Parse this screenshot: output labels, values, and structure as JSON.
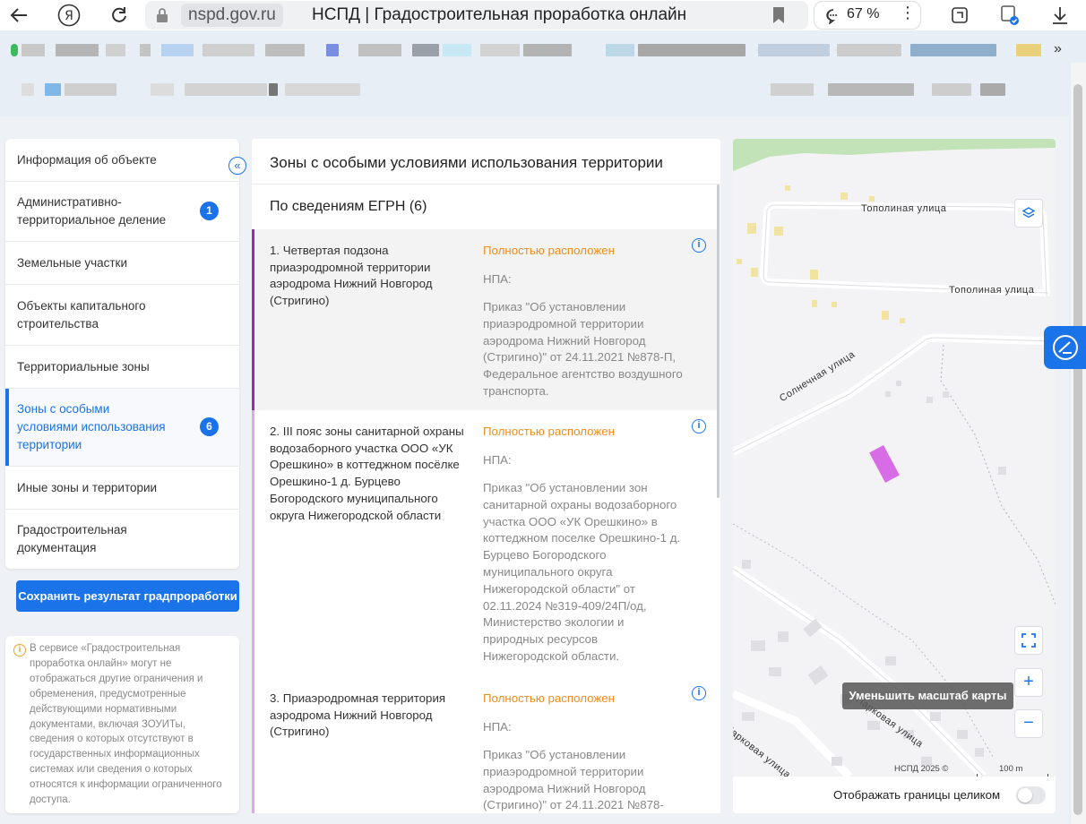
{
  "browser": {
    "domain": "nspd.gov.ru",
    "title": "НСПД | Градостроительная проработка онлайн",
    "zoom": "67 %"
  },
  "nav": {
    "collapse_symbol": "«",
    "items": [
      {
        "label": "Информация об объекте"
      },
      {
        "label": "Административно-\nтерриториальное деление",
        "badge": "1"
      },
      {
        "label": "Земельные участки"
      },
      {
        "label": "Объекты капитального\nстроительства"
      },
      {
        "label": "Территориальные зоны"
      },
      {
        "label": "Зоны с особыми\nусловиями использования\nтерритории",
        "badge": "6",
        "active": true
      },
      {
        "label": "Иные зоны и территории"
      },
      {
        "label": "Градостроительная\nдокументация"
      }
    ]
  },
  "save_button": "Сохранить результат градпроработки",
  "info_note": "В сервисе «Градостроительная проработка онлайн» могут не отображаться другие ограничения и обременения, предусмотренные действующими нормативными документами, включая ЗОУИТы, сведения о которых отсутствуют в государственных информационных системах или сведения о которых относятся к информации ограниченного доступа.",
  "main": {
    "title": "Зоны с особыми условиями использования территории",
    "section": "По сведениям ЕГРН (6)",
    "npa_label": "НПА:",
    "zones": [
      {
        "name": "1. Четвертая подзона приаэродромной территории аэродрома Нижний Новгород (Стригино)",
        "status": "Полностью расположен",
        "npa": "Приказ \"Об установлении приаэродромной территории аэродрома Нижний Новгород (Стригино)\" от 24.11.2021 №878-П, Федеральное агентство воздушного транспорта.",
        "color": "#9c27b0"
      },
      {
        "name": "2. III пояс зоны санитарной охраны водозаборного участка ООО «УК Орешкино» в коттеджном посёлке Орешкино-1 д. Бурцево Богородского муниципального округа Нижегородской области",
        "status": "Полностью расположен",
        "npa": "Приказ \"Об установлении зон санитарной охраны водозаборного участка ООО «УК Орешкино» в коттеджном поселке Орешкино-1 д. Бурцево Богородского муниципального округа Нижегородской области\" от 02.11.2024 №319-409/24П/од, Министерство экологии и природных ресурсов Нижегородской области.",
        "color": "#e0a8e8"
      },
      {
        "name": "3. Приаэродромная территория аэродрома Нижний Новгород (Стригино)",
        "status": "Полностью расположен",
        "npa": "Приказ \"Об установлении приаэродромной территории аэродрома Нижний Новгород (Стригино)\" от 24.11.2021 №878-",
        "color": "#e0a8e8"
      }
    ]
  },
  "map": {
    "streets": [
      "Тополиная улица",
      "Тополиная улица",
      "Солнечная улица",
      "Парковая улица",
      "Парковая улица"
    ],
    "tooltip": "Уменьшить масштаб карты",
    "attribution": "НСПД 2025 ©",
    "scale": "100 m",
    "toggle_label": "Отображать границы целиком",
    "zoom_in": "+",
    "zoom_out": "−",
    "parcel_color": "#d86be6"
  }
}
